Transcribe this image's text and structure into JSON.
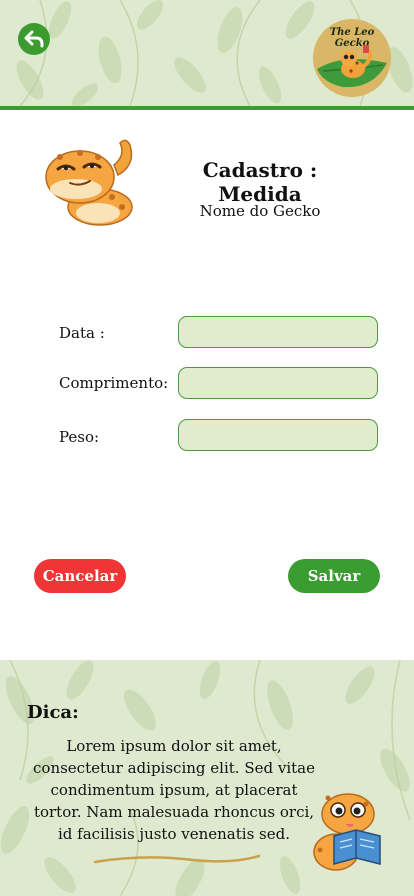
{
  "header": {
    "back_icon": "back-arrow-icon",
    "logo_text_line1": "The Leo",
    "logo_text_line2": "Gecko"
  },
  "form": {
    "title": "Cadastro : Medida",
    "subtitle": "Nome do Gecko",
    "fields": [
      {
        "label": "Data :",
        "value": "",
        "placeholder": ""
      },
      {
        "label": "Comprimento:",
        "value": "",
        "placeholder": ""
      },
      {
        "label": "Peso:",
        "value": "",
        "placeholder": ""
      }
    ],
    "cancel_label": "Cancelar",
    "save_label": "Salvar"
  },
  "tip": {
    "title": "Dica:",
    "text": "Lorem ipsum dolor sit amet, consectetur adipiscing elit. Sed vitae condimentum ipsum, at placerat tortor. Nam malesuada rhoncus orci, id facilisis justo venenatis sed."
  },
  "colors": {
    "accent_green": "#3a9c31",
    "cancel_red": "#ef3535",
    "field_fill": "#dfeccd",
    "leaf_background": "#dfe9cf"
  }
}
